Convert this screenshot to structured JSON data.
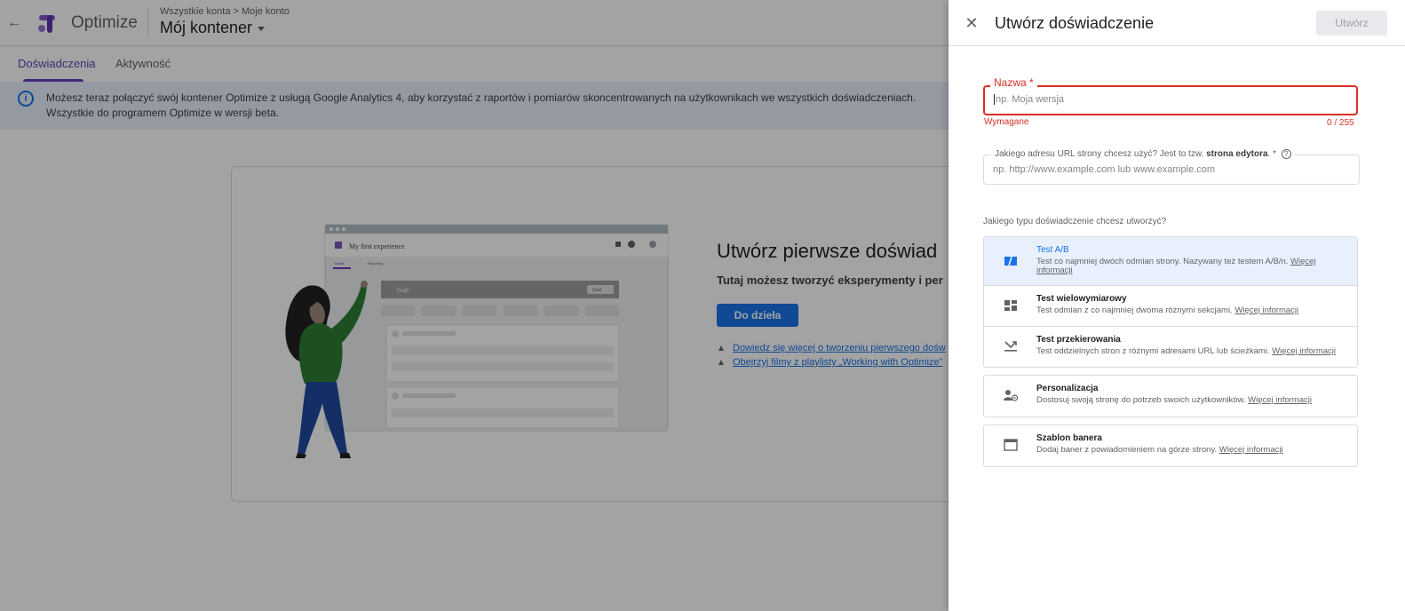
{
  "app": {
    "product_name": "Optimize",
    "breadcrumbs": "Wszystkie konta > Moje konto",
    "container_name": "Mój kontener",
    "tabs": [
      "Doświadczenia",
      "Aktywność"
    ],
    "info_banner": "Możesz teraz połączyć swój kontener Optimize z usługą Google Analytics 4, aby korzystać z raportów i pomiarów skoncentrowanych na użytkownikach we wszystkich doświadczeniach. Wszystkie do programem Optimize w wersji beta.",
    "empty_state": {
      "title": "Utwórz pierwsze doświad",
      "subtitle": "Tutaj możesz tworzyć eksperymenty i per",
      "cta": "Do dzieła",
      "links": [
        "Dowiedz się więcej o tworzeniu pierwszego dośw",
        "Obejrzyj filmy z playlisty „Working with Optimize”"
      ]
    },
    "illustration": {
      "window_title": "My first experience",
      "tab_label_1": "Detail",
      "tab_label_2": "Reporting",
      "draft_label": "Draft",
      "start_label": "Start"
    }
  },
  "drawer": {
    "title": "Utwórz doświadczenie",
    "create_button": "Utwórz",
    "name_field": {
      "label": "Nazwa *",
      "placeholder": "np. Moja wersja",
      "error": "Wymagane",
      "counter": "0 / 255"
    },
    "url_field": {
      "label_prefix": "Jakiego adresu URL strony chcesz użyć? Jest to tzw.",
      "label_bold": "strona edytora",
      "label_suffix": ". *",
      "placeholder": "np. http://www.example.com lub www.example.com"
    },
    "type_question": "Jakiego typu doświadczenie chcesz utworzyć?",
    "more_info": "Więcej informacji",
    "types": [
      {
        "name": "Test A/B",
        "desc": "Test co najmniej dwóch odmian strony. Nazywany też testem A/B/n.",
        "icon": "ab-test-icon"
      },
      {
        "name": "Test wielowymiarowy",
        "desc": "Test odmian z co najmniej dwoma różnymi sekcjami.",
        "icon": "multivariate-icon"
      },
      {
        "name": "Test przekierowania",
        "desc": "Test oddzielnych stron z różnymi adresami URL lub ścieżkami.",
        "icon": "redirect-icon"
      },
      {
        "name": "Personalizacja",
        "desc": "Dostosuj swoją stronę do potrzeb swoich użytkowników.",
        "icon": "personalization-icon"
      },
      {
        "name": "Szablon banera",
        "desc": "Dodaj baner z powiadomieniem na górze strony.",
        "icon": "banner-icon"
      }
    ]
  },
  "colors": {
    "accent": "#673ab7",
    "primary": "#1a73e8",
    "error": "#d93025",
    "banner_bg": "#e8f0fe"
  }
}
